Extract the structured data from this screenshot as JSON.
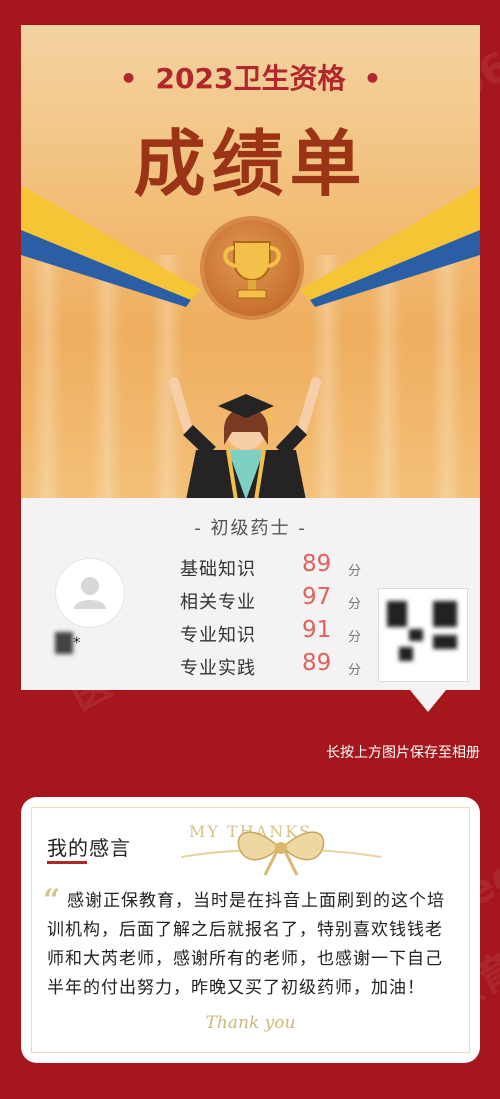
{
  "poster": {
    "year_title": "2023卫生资格",
    "main_title": "成绩单",
    "dot": "•"
  },
  "panel": {
    "category": "- 初级药士 -",
    "name": "*",
    "rows": [
      {
        "subject": "基础知识",
        "score": "89",
        "unit": "分"
      },
      {
        "subject": "相关专业",
        "score": "97",
        "unit": "分"
      },
      {
        "subject": "专业知识",
        "score": "91",
        "unit": "分"
      },
      {
        "subject": "专业实践",
        "score": "89",
        "unit": "分"
      }
    ]
  },
  "hint": "长按上方图片保存至相册",
  "card": {
    "title": "我的感言",
    "ribbon_text": "MY  THANKS",
    "quote_mark": "“",
    "text": "感谢正保教育，当时是在抖音上面刷到的这个培训机构，后面了解之后就报名了，特别喜欢钱钱老师和大芮老师，感谢所有的老师，也感谢一下自己半年的付出努力，昨晚又买了初级药师，加油！",
    "thanks": "Thank you"
  },
  "watermark": {
    "brand": "医学教育网",
    "url": "www.med66.com"
  },
  "colors": {
    "background": "#a5171d",
    "title_red": "#b1282c",
    "score_red": "#e0615c",
    "gold": "#d6c38c"
  }
}
